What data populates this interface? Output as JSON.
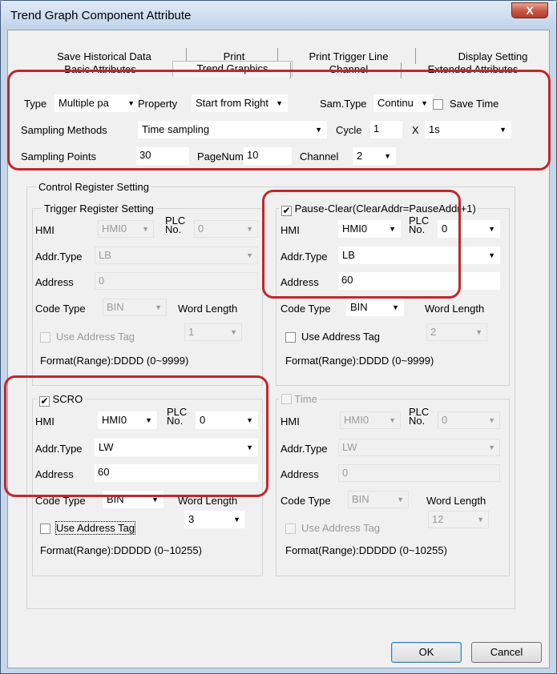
{
  "window": {
    "title": "Trend Graph Component Attribute",
    "close_label": "X"
  },
  "tabs_row1": [
    "Save Historical Data",
    "Print",
    "Print Trigger Line",
    "Display Setting"
  ],
  "tabs_row2": [
    "Basic Attributes",
    "Trend Graphics",
    "Channel",
    "Extended Attributes"
  ],
  "trend": {
    "type_label": "Type",
    "type_value": "Multiple pa",
    "property_label": "Property",
    "property_value": "Start from Right",
    "samtype_label": "Sam.Type",
    "samtype_value": "Continu",
    "save_time_label": "Save Time",
    "sampling_methods_label": "Sampling Methods",
    "sampling_methods_value": "Time sampling",
    "cycle_label": "Cycle",
    "cycle_value": "1",
    "x_label": "X",
    "cycle_unit": "1s",
    "sampling_points_label": "Sampling Points",
    "sampling_points_value": "30",
    "pagenum_label": "PageNum",
    "pagenum_value": "10",
    "channel_label": "Channel",
    "channel_value": "2"
  },
  "control": {
    "legend": "Control Register Setting"
  },
  "trigger": {
    "legend": "Trigger Register Setting",
    "hmi_label": "HMI",
    "hmi_value": "HMI0",
    "plc_label": "PLC\nNo.",
    "plc_value": "0",
    "addr_type_label": "Addr.Type",
    "addr_type_value": "LB",
    "address_label": "Address",
    "address_value": "0",
    "code_type_label": "Code Type",
    "code_type_value": "BIN",
    "word_length_label": "Word Length",
    "word_length_value": "1",
    "use_tag_label": "Use Address Tag",
    "format_label": "Format(Range):DDDD (0~9999)"
  },
  "pause": {
    "legend": "Pause-Clear(ClearAddr=PauseAddr+1)",
    "checked_mark": "✔",
    "hmi_label": "HMI",
    "hmi_value": "HMI0",
    "plc_label": "PLC\nNo.",
    "plc_value": "0",
    "addr_type_label": "Addr.Type",
    "addr_type_value": "LB",
    "address_label": "Address",
    "address_value": "60",
    "code_type_label": "Code Type",
    "code_type_value": "BIN",
    "word_length_label": "Word Length",
    "word_length_value": "2",
    "use_tag_label": "Use Address Tag",
    "format_label": "Format(Range):DDDD (0~9999)"
  },
  "scro": {
    "legend": "SCRO",
    "checked_mark": "✔",
    "hmi_label": "HMI",
    "hmi_value": "HMI0",
    "plc_label": "PLC\nNo.",
    "plc_value": "0",
    "addr_type_label": "Addr.Type",
    "addr_type_value": "LW",
    "address_label": "Address",
    "address_value": "60",
    "code_type_label": "Code Type",
    "code_type_value": "BIN",
    "word_length_label": "Word Length",
    "word_length_value": "3",
    "use_tag_label": "Use Address Tag",
    "format_label": "Format(Range):DDDDD (0~10255)"
  },
  "time": {
    "legend": "Time",
    "hmi_label": "HMI",
    "hmi_value": "HMI0",
    "plc_label": "PLC\nNo.",
    "plc_value": "0",
    "addr_type_label": "Addr.Type",
    "addr_type_value": "LW",
    "address_label": "Address",
    "address_value": "0",
    "code_type_label": "Code Type",
    "code_type_value": "BIN",
    "word_length_label": "Word Length",
    "word_length_value": "12",
    "use_tag_label": "Use Address Tag",
    "format_label": "Format(Range):DDDDD (0~10255)"
  },
  "buttons": {
    "ok": "OK",
    "cancel": "Cancel"
  },
  "colors": {
    "highlight": "#c0282c",
    "titlebar": "#c6d6e8",
    "close": "#c75c47"
  },
  "arrow_glyph": "▼"
}
